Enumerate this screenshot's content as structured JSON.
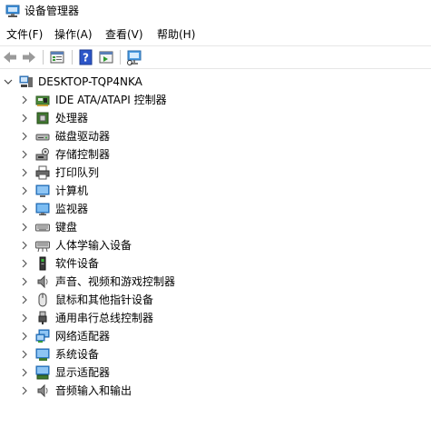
{
  "window": {
    "title": "设备管理器"
  },
  "menu": [
    "文件(F)",
    "操作(A)",
    "查看(V)",
    "帮助(H)"
  ],
  "toolbar": {
    "buttons": [
      "back-icon",
      "forward-icon",
      "properties-icon",
      "help-icon",
      "run-icon",
      "monitor-scan-icon"
    ]
  },
  "tree": {
    "root": {
      "label": "DESKTOP-TQP4NKA",
      "expanded": true
    },
    "items": [
      {
        "label": "IDE ATA/ATAPI 控制器",
        "icon": "ide-controller-icon"
      },
      {
        "label": "处理器",
        "icon": "processor-icon"
      },
      {
        "label": "磁盘驱动器",
        "icon": "disk-drive-icon"
      },
      {
        "label": "存储控制器",
        "icon": "storage-controller-icon"
      },
      {
        "label": "打印队列",
        "icon": "printer-icon"
      },
      {
        "label": "计算机",
        "icon": "computer-icon"
      },
      {
        "label": "监视器",
        "icon": "monitor-icon"
      },
      {
        "label": "键盘",
        "icon": "keyboard-icon"
      },
      {
        "label": "人体学输入设备",
        "icon": "hid-icon"
      },
      {
        "label": "软件设备",
        "icon": "software-device-icon"
      },
      {
        "label": "声音、视频和游戏控制器",
        "icon": "speaker-icon"
      },
      {
        "label": "鼠标和其他指针设备",
        "icon": "mouse-icon"
      },
      {
        "label": "通用串行总线控制器",
        "icon": "usb-icon"
      },
      {
        "label": "网络适配器",
        "icon": "network-adapter-icon"
      },
      {
        "label": "系统设备",
        "icon": "system-device-icon"
      },
      {
        "label": "显示适配器",
        "icon": "display-adapter-icon"
      },
      {
        "label": "音频输入和输出",
        "icon": "audio-io-icon"
      }
    ]
  }
}
